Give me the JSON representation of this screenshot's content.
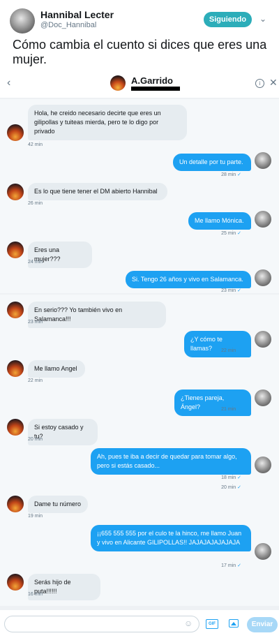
{
  "tweet": {
    "author_name": "Hannibal Lecter",
    "author_handle": "@Doc_Hannibal",
    "follow_label": "Siguiendo",
    "text": "Cómo cambia el cuento si dices que eres una mujer."
  },
  "dm": {
    "contact_name": "A.Garrido",
    "send_label": "Enviar",
    "gif_label": "GIF",
    "messages": [
      {
        "dir": "in",
        "text": "Hola, he creido necesario decirte que eres un gilipollas y tuiteas mierda, pero te lo digo por privado",
        "time": "42 min"
      },
      {
        "dir": "out",
        "text": "Un detalle por tu parte.",
        "time": "28 min"
      },
      {
        "dir": "in",
        "text": "Es lo que tiene tener el DM abierto Hannibal",
        "time": "26 min"
      },
      {
        "dir": "out",
        "text": "Me llamo Mónica.",
        "time": "25 min"
      },
      {
        "dir": "in",
        "text": "Eres una mujer???",
        "time": "24 min"
      },
      {
        "dir": "out",
        "text": "Si. Tengo 26 años y vivo en Salamanca.",
        "time": "23 min"
      },
      {
        "dir": "in",
        "text": "En serio??? Yo también vivo en Salamanca!!!",
        "time": "23 min"
      },
      {
        "dir": "out",
        "text": "¿Y cómo te llamas?",
        "time": "22 min"
      },
      {
        "dir": "in",
        "text": "Me llamo Angel",
        "time": "22 min"
      },
      {
        "dir": "out",
        "text": "¿Tienes pareja, Ángel?",
        "time": "21 min"
      },
      {
        "dir": "in",
        "text": "Si estoy casado y tu?",
        "time": "20 min"
      },
      {
        "dir": "out",
        "text": "Ah, pues te iba a decir de quedar para tomar algo, pero si estás casado...",
        "time": "18 min",
        "time2": "20 min"
      },
      {
        "dir": "in",
        "text": "Dame tu número",
        "time": "19 min"
      },
      {
        "dir": "out",
        "text": "¡¡655 555 555 por el culo te la hinco, me llamo Juan y vivo en Alicante GILIPOLLAS!! JAJAJAJAJAJAJA",
        "time": "17 min"
      },
      {
        "dir": "in",
        "text": "Serás hijo de puta!!!!!!",
        "time": "16 min"
      }
    ]
  }
}
